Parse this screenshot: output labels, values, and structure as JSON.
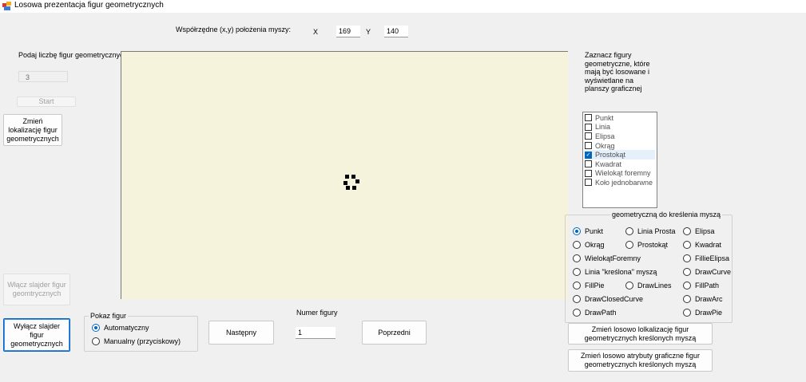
{
  "window": {
    "title": "Losowa prezentacja figur geometrycznych"
  },
  "mouse": {
    "label": "Współrzędne (x,y) położenia myszy:",
    "x_label": "X",
    "x_value": "169",
    "y_label": "Y",
    "y_value": "140"
  },
  "figure_count": {
    "label": "Podaj liczbę figur geometrycznych",
    "value": "3"
  },
  "buttons": {
    "start": "Start",
    "change_location": "Zmień lokalizację figur geometrycznych",
    "enable_slider": "Włącz slajder figur geomtrycznych",
    "disable_slider": "Wyłącz slajder figur geometrycznych",
    "next": "Następny",
    "previous": "Poprzedni",
    "random_location_mouse": "Zmień losowo lolkalizację figur geometrycznych kreślonych myszą",
    "random_attributes_mouse": "Zmień losowo atrybuty graficzne figur geometrycznych kreślonych myszą"
  },
  "show_figures": {
    "title": "Pokaz figur",
    "options": [
      "Automatyczny",
      "Manualny (przyciskowy)"
    ],
    "selected": "Automatyczny"
  },
  "figure_number": {
    "label": "Numer figury",
    "value": "1"
  },
  "figure_select": {
    "label": "Zaznacz figury geometryczne, które mają być losowane i wyświetlane na planszy graficznej",
    "items": [
      {
        "label": "Punkt",
        "checked": false
      },
      {
        "label": "Linia",
        "checked": false
      },
      {
        "label": "Elipsa",
        "checked": false
      },
      {
        "label": "Okrąg",
        "checked": false
      },
      {
        "label": "Prostokąt",
        "checked": true
      },
      {
        "label": "Kwadrat",
        "checked": false
      },
      {
        "label": "Wielokąt foremny",
        "checked": false
      },
      {
        "label": "Koło jednobarwne",
        "checked": false
      }
    ]
  },
  "mouse_draw": {
    "title": "geometryczną do kreślenia myszą",
    "options": [
      "Punkt",
      "Linia Prosta",
      "Elipsa",
      "Okrąg",
      "Prostokąt",
      "Kwadrat",
      "WielokątForemny",
      "FillieElipsa",
      "Linia \"kreślona\" myszą",
      "DrawCurve",
      "FillPie",
      "DrawLines",
      "FillPath",
      "DrawClosedCurve",
      "DrawArc",
      "DrawPath",
      "DrawPie"
    ],
    "selected": "Punkt"
  },
  "colors": {
    "canvas": "#f5f3dc",
    "accent": "#0067c0"
  }
}
